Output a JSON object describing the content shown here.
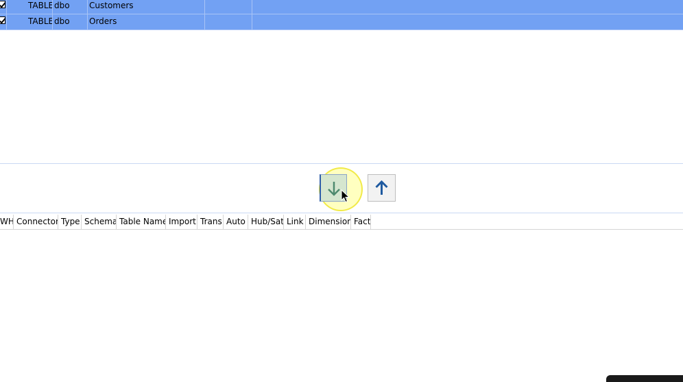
{
  "source_grid": {
    "rows": [
      {
        "checked": true,
        "type": "TABLE",
        "schema": "dbo",
        "name": "Customers"
      },
      {
        "checked": true,
        "type": "TABLE",
        "schema": "dbo",
        "name": "Orders"
      }
    ],
    "selected_color": "#72a1f3"
  },
  "toolbar": {
    "move_down_icon": "arrow-down-icon",
    "move_up_icon": "arrow-up-icon",
    "accent": "#1f5aa0"
  },
  "target_grid": {
    "columns": [
      "WH",
      "Connector",
      "Type",
      "Schema",
      "Table Name",
      "Import",
      "Trans",
      "Auto",
      "Hub/Sat",
      "Link",
      "Dimension",
      "Fact"
    ]
  }
}
